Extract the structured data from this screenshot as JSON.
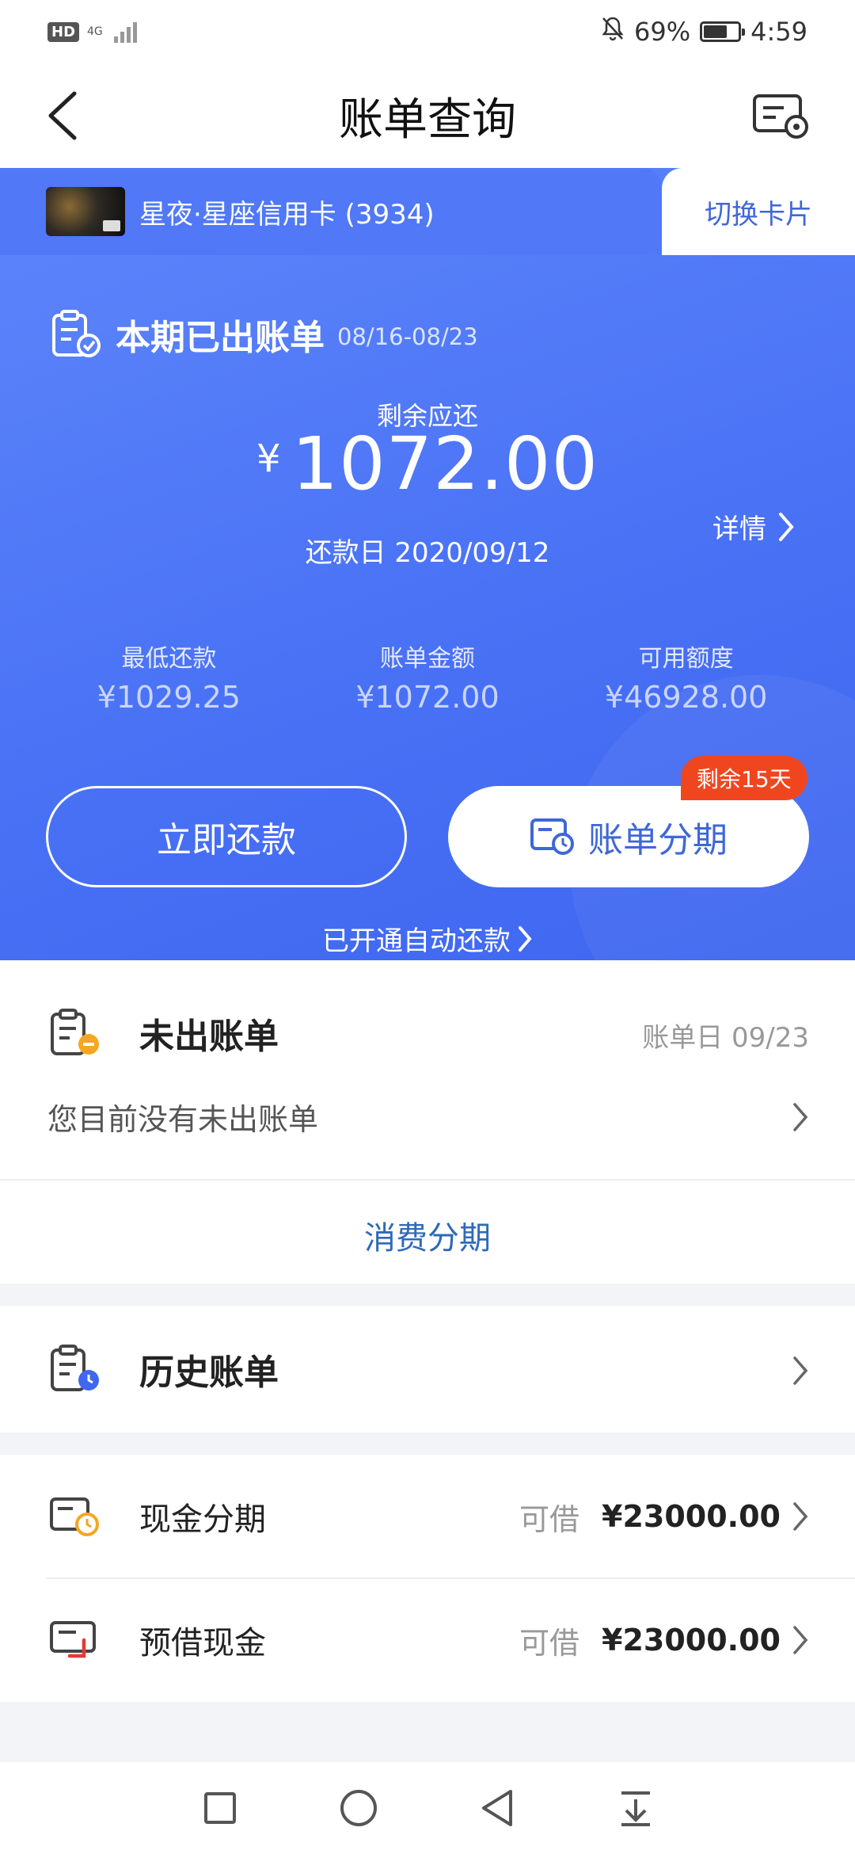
{
  "status_bar": {
    "hd": "HD",
    "network": "4G",
    "battery": "69%",
    "time": "4:59"
  },
  "header": {
    "title": "账单查询"
  },
  "card": {
    "name": "星夜·星座信用卡 (3934)",
    "switch_label": "切换卡片"
  },
  "current_bill": {
    "title": "本期已出账单",
    "period": "08/16-08/23",
    "remaining_label": "剩余应还",
    "currency": "¥",
    "remaining_amount": "1072.00",
    "due_date": "还款日 2020/09/12",
    "detail_label": "详情",
    "stats": [
      {
        "label": "最低还款",
        "value": "¥1029.25"
      },
      {
        "label": "账单金额",
        "value": "¥1072.00"
      },
      {
        "label": "可用额度",
        "value": "¥46928.00"
      }
    ],
    "pay_now_label": "立即还款",
    "installment_label": "账单分期",
    "days_left_badge": "剩余15天",
    "autopay_label": "已开通自动还款"
  },
  "unbilled": {
    "title": "未出账单",
    "bill_day": "账单日 09/23",
    "message": "您目前没有未出账单",
    "consume_installment_label": "消费分期"
  },
  "history": {
    "title": "历史账单"
  },
  "cash": [
    {
      "name": "现金分期",
      "label": "可借",
      "amount": "¥23000.00"
    },
    {
      "name": "预借现金",
      "label": "可借",
      "amount": "¥23000.00"
    }
  ],
  "colors": {
    "primary_blue": "#4a72f5",
    "link_blue": "#2f6ab8",
    "badge_red": "#f0461f",
    "accent_orange": "#f5a623"
  }
}
